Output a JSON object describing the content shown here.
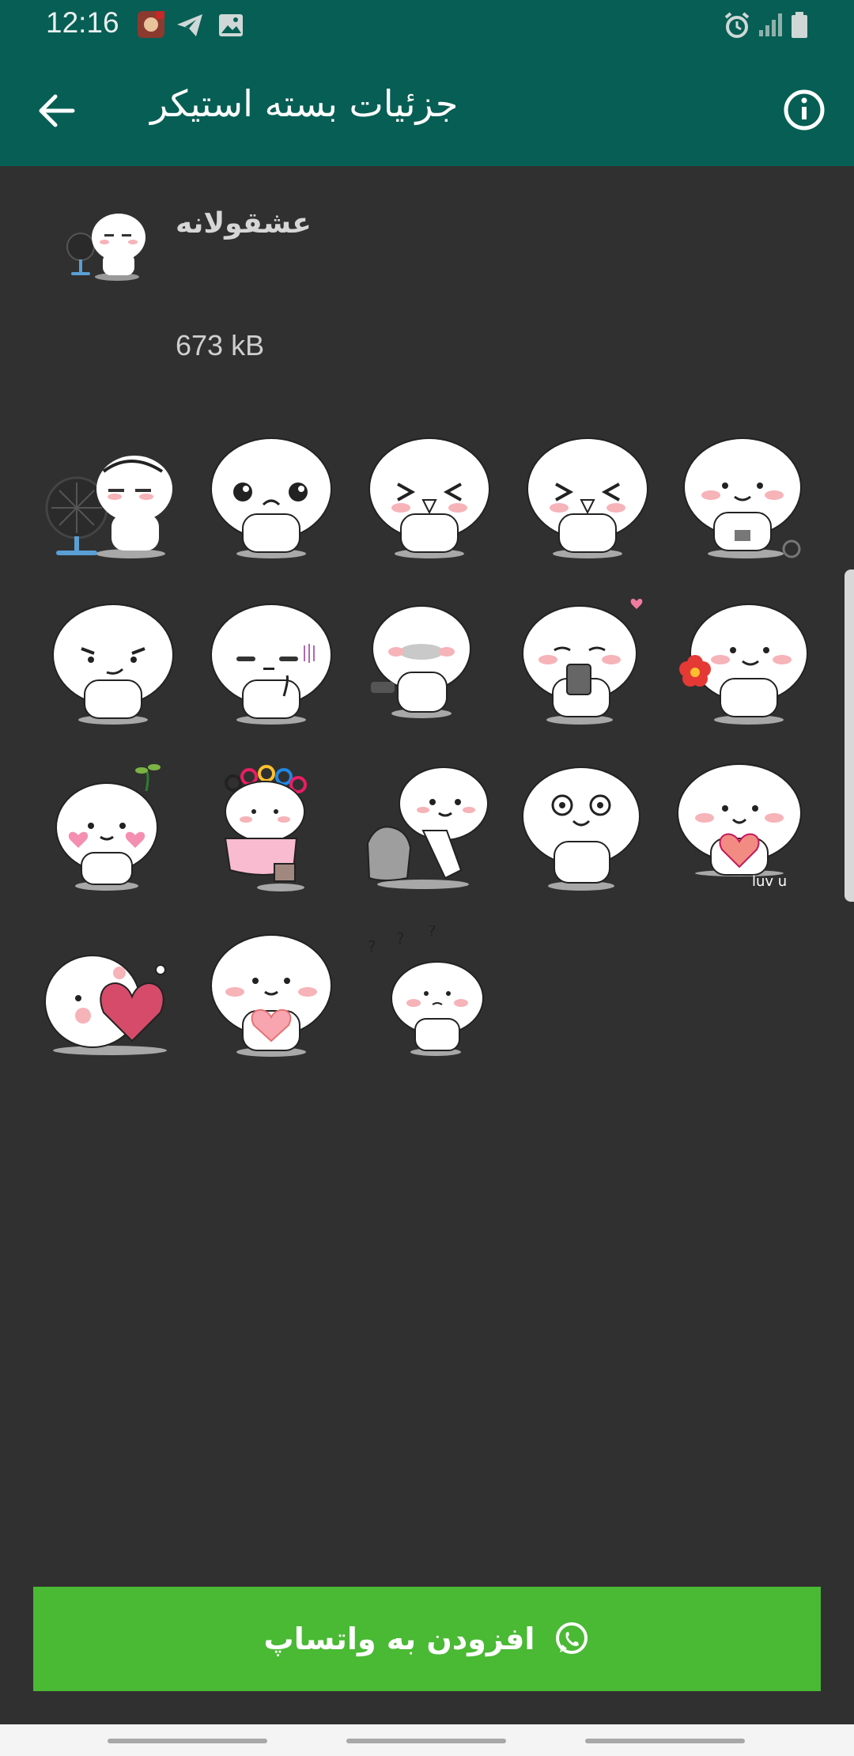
{
  "status_bar": {
    "time": "12:16",
    "icons": [
      "game-notification-icon",
      "telegram-icon",
      "gallery-icon",
      "alarm-icon",
      "signal-icon",
      "battery-icon"
    ]
  },
  "app_bar": {
    "title": "جزئیات بسته استیکر",
    "back_icon": "arrow-back-icon",
    "info_icon": "info-icon",
    "color": "#075e54"
  },
  "pack": {
    "name": "عشقولانه",
    "size": "673 kB"
  },
  "stickers": [
    "fan-sticker",
    "sad-sticker",
    "laughing-sticker",
    "laughing-sticker",
    "knitting-sticker",
    "smirk-sticker",
    "sleepy-sticker",
    "blushing-sticker",
    "phone-sticker",
    "flower-sticker",
    "sprout-sticker",
    "bath-sticker",
    "pushing-sticker",
    "big-eyes-sticker",
    "luv-u-sticker",
    "big-heart-sticker",
    "heart-sticker",
    "confused-sticker"
  ],
  "sticker_texts": {
    "luv_u": "luv u"
  },
  "add_button": {
    "label": "افزودن به واتساپ",
    "icon": "whatsapp-icon",
    "color": "#4ab934"
  }
}
